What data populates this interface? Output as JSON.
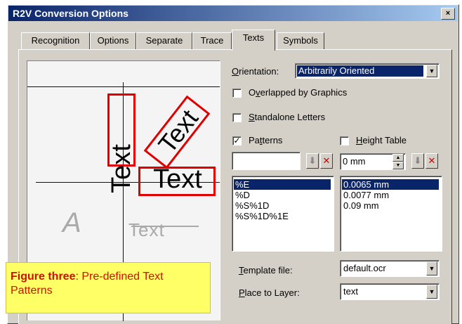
{
  "window": {
    "title": "R2V Conversion Options",
    "close_glyph": "×"
  },
  "tabs": [
    {
      "label": "Recognition"
    },
    {
      "label": "Options"
    },
    {
      "label": "Separate"
    },
    {
      "label": "Trace"
    },
    {
      "label": "Texts"
    },
    {
      "label": "Symbols"
    }
  ],
  "active_tab": "Texts",
  "preview": {
    "vertical_text": "Text",
    "diagonal_text": "Text",
    "horizontal_text": "Text",
    "faded_letter": "A",
    "faded_text": "Text"
  },
  "orientation": {
    "label_prefix": "",
    "label_u": "O",
    "label_rest": "rientation:",
    "value": "Arbitrarily Oriented"
  },
  "checks": {
    "overlapped": {
      "u": "v",
      "pre": "O",
      "rest": "erlapped by Graphics",
      "checked": false
    },
    "standalone": {
      "u": "S",
      "pre": "",
      "rest": "tandalone Letters",
      "checked": false
    },
    "patterns": {
      "u": "t",
      "pre": "Pa",
      "rest": "terns",
      "checked": true
    },
    "height_table": {
      "u": "H",
      "pre": "",
      "rest": "eight Table",
      "checked": false
    }
  },
  "pattern_input": {
    "value": ""
  },
  "height_input": {
    "value": "0 mm"
  },
  "patterns_list": [
    "%E",
    "%D",
    "%S%1D",
    "%S%1D%1E"
  ],
  "heights_list": [
    "0.0065 mm",
    "0.0077 mm",
    "0.09 mm"
  ],
  "template": {
    "u": "T",
    "rest": "emplate file:",
    "value": "default.ocr"
  },
  "layer": {
    "u": "P",
    "rest": "lace to Layer:",
    "value": "text"
  },
  "caption": {
    "bold": "Figure three",
    "rest": ": Pre-defined Text Patterns"
  },
  "colors": {
    "selection": "#0a246a",
    "highlight_box": "#e00000",
    "caption_bg": "#ffff66",
    "caption_text": "#cc1100"
  }
}
